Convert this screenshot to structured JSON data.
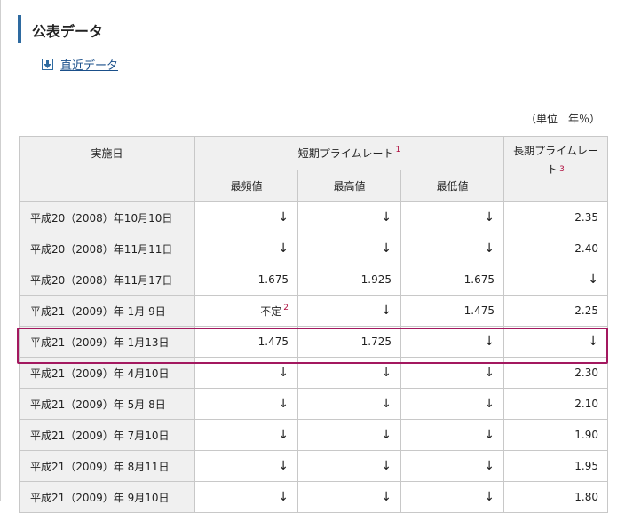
{
  "section": {
    "title": "公表データ"
  },
  "recent_link": {
    "label": "直近データ"
  },
  "unit_note": "（単位　年％）",
  "table": {
    "headers": {
      "date": "実施日",
      "short_group": "短期プライムレート",
      "short_note": "1",
      "most_frequent": "最頻値",
      "highest": "最高値",
      "lowest": "最低値",
      "long": "長期プライムレート",
      "long_note": "3"
    },
    "rows": [
      {
        "date": "平成20（2008）年10月10日",
        "mode": "↓",
        "high": "↓",
        "low": "↓",
        "long": "2.35"
      },
      {
        "date": "平成20（2008）年11月11日",
        "mode": "↓",
        "high": "↓",
        "low": "↓",
        "long": "2.40"
      },
      {
        "date": "平成20（2008）年11月17日",
        "mode": "1.675",
        "high": "1.925",
        "low": "1.675",
        "long": "↓"
      },
      {
        "date": "平成21（2009）年 1月 9日",
        "mode": "不定",
        "mode_note": "2",
        "high": "↓",
        "low": "1.475",
        "long": "2.25"
      },
      {
        "date": "平成21（2009）年 1月13日",
        "mode": "1.475",
        "high": "1.725",
        "low": "↓",
        "long": "↓"
      },
      {
        "date": "平成21（2009）年 4月10日",
        "mode": "↓",
        "high": "↓",
        "low": "↓",
        "long": "2.30"
      },
      {
        "date": "平成21（2009）年 5月 8日",
        "mode": "↓",
        "high": "↓",
        "low": "↓",
        "long": "2.10"
      },
      {
        "date": "平成21（2009）年 7月10日",
        "mode": "↓",
        "high": "↓",
        "low": "↓",
        "long": "1.90"
      },
      {
        "date": "平成21（2009）年 8月11日",
        "mode": "↓",
        "high": "↓",
        "low": "↓",
        "long": "1.95"
      },
      {
        "date": "平成21（2009）年 9月10日",
        "mode": "↓",
        "high": "↓",
        "low": "↓",
        "long": "1.80"
      }
    ]
  },
  "highlight_row_index": 4,
  "colors": {
    "accent": "#2e6aa0",
    "link": "#1a4f8a",
    "note": "#b01040",
    "highlight": "#a3185f",
    "header_bg": "#f0f0f0"
  },
  "icons": {
    "download": "arrow-down-box-icon"
  }
}
